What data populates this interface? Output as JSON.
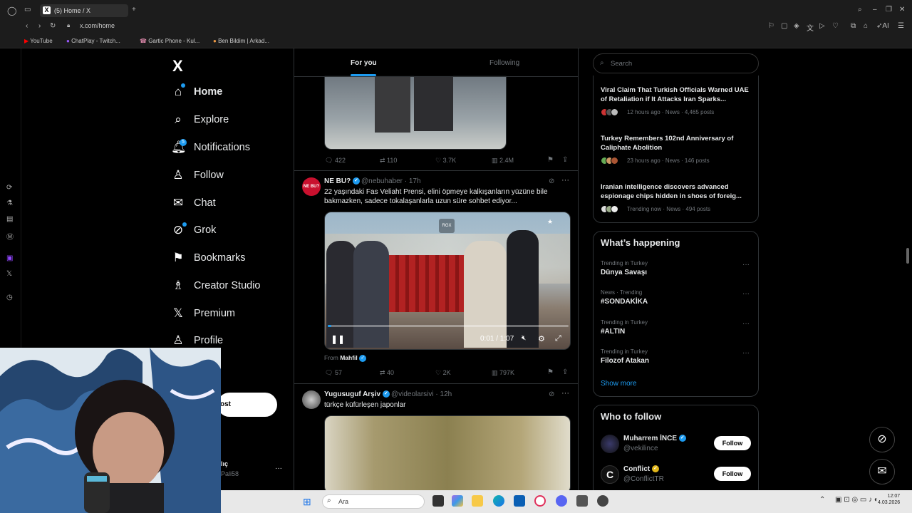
{
  "browser": {
    "tab_title": "(5) Home / X",
    "url": "x.com/home",
    "bookmarks": [
      "YouTube",
      "ChatPlay - Twitch...",
      "Gartic Phone - Kul...",
      "Ben Bildim | Arkad..."
    ],
    "ai_label": "AI"
  },
  "nav": {
    "logo": "X",
    "items": [
      {
        "label": "Home",
        "icon": "home-icon"
      },
      {
        "label": "Explore",
        "icon": "search-icon"
      },
      {
        "label": "Notifications",
        "icon": "bell-icon",
        "badge": "5"
      },
      {
        "label": "Follow",
        "icon": "person-add-icon"
      },
      {
        "label": "Chat",
        "icon": "mail-icon"
      },
      {
        "label": "Grok",
        "icon": "grok-icon"
      },
      {
        "label": "Bookmarks",
        "icon": "bookmark-icon"
      },
      {
        "label": "Creator Studio",
        "icon": "creator-icon"
      },
      {
        "label": "Premium",
        "icon": "x-icon"
      },
      {
        "label": "Profile",
        "icon": "person-icon"
      }
    ],
    "post_label": "ost",
    "account_partial_name": "lıç",
    "account_partial_handle": "Pali58",
    "account_more": "···"
  },
  "feed": {
    "tabs": [
      "For you",
      "Following"
    ],
    "post1": {
      "replies": "422",
      "reposts": "110",
      "likes": "3.7K",
      "views": "2.4M"
    },
    "post2": {
      "avatar_text": "NE BU?",
      "name": "NE BU?",
      "handle": "@nebuhaber",
      "time": "· 17h",
      "text": "22 yaşındaki Fas Veliaht Prensi, elini öpmeye kalkışanların yüzüne bile bakmazken, sadece tokalaşanlarla uzun süre sohbet ediyor...",
      "video_time": "0:01 / 1:07",
      "video_progress": 0.016,
      "from_label": "From",
      "from_name": "Mahfil",
      "replies": "57",
      "reposts": "40",
      "likes": "2K",
      "views": "797K",
      "watermark": "RGX"
    },
    "post3": {
      "name": "Yugusuguf Arşiv",
      "handle": "@videolarsivi",
      "time": "· 12h",
      "text": "türkçe küfürleşen japonlar"
    }
  },
  "right": {
    "search_placeholder": "Search",
    "news": [
      {
        "title": "Viral Claim That Turkish Officials Warned UAE of Retaliation if It Attacks Iran Sparks...",
        "meta": "12 hours ago · News · 4,465 posts"
      },
      {
        "title": "Turkey Remembers 102nd Anniversary of Caliphate Abolition",
        "meta": "23 hours ago · News · 146 posts"
      },
      {
        "title": "Iranian intelligence discovers advanced espionage chips hidden in shoes of foreig...",
        "meta": "Trending now · News · 494 posts"
      }
    ],
    "happening_title": "What’s happening",
    "trends": [
      {
        "context": "Trending in Turkey",
        "name": "Dünya Savaşı"
      },
      {
        "context": "News · Trending",
        "name": "#SONDAKİKA"
      },
      {
        "context": "Trending in Turkey",
        "name": "#ALTIN"
      },
      {
        "context": "Trending in Turkey",
        "name": "Filozof Atakan"
      }
    ],
    "show_more": "Show more",
    "who_title": "Who to follow",
    "follow": [
      {
        "name": "Muharrem İNCE",
        "handle": "@vekilince",
        "button": "Follow"
      },
      {
        "name": "Conflict",
        "handle": "@ConflictTR",
        "button": "Follow"
      }
    ]
  },
  "taskbar": {
    "search_placeholder": "Ara",
    "time": "12:07",
    "date": "4.03.2026"
  }
}
